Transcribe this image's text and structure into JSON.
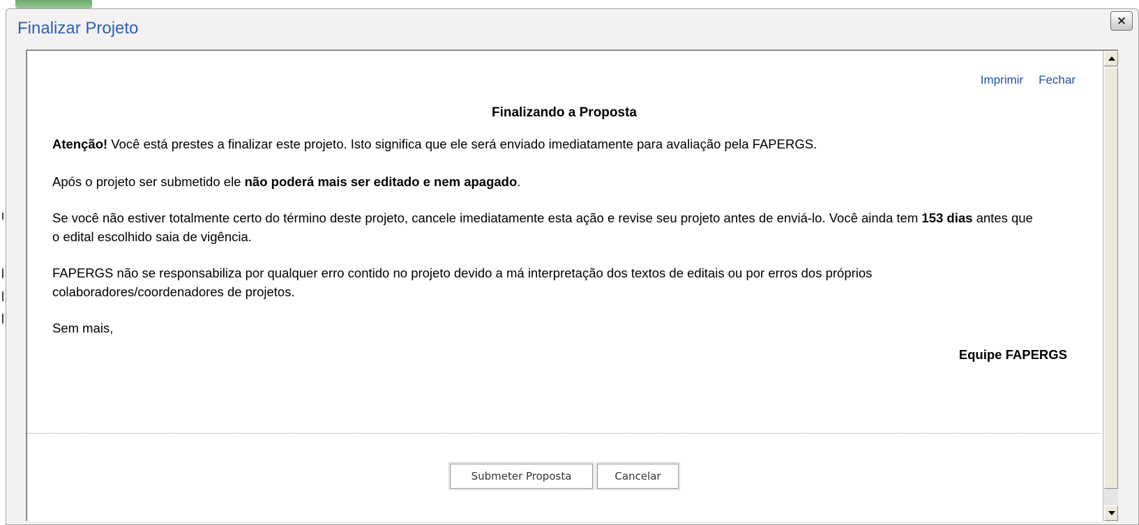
{
  "dialog": {
    "title": "Finalizar Projeto",
    "close_label": "×"
  },
  "links": {
    "print": "Imprimir",
    "close": "Fechar"
  },
  "content": {
    "heading": "Finalizando a Proposta",
    "p1_bold": "Atenção!",
    "p1_text": " Você está prestes a finalizar este projeto. Isto significa que ele será enviado imediatamente para avaliação pela FAPERGS.",
    "p2_text": "Após o projeto ser submetido ele ",
    "p2_bold": "não poderá mais ser editado e nem apagado",
    "p2_end": ".",
    "p3_text": "Se você não estiver totalmente certo do término deste projeto, cancele imediatamente esta ação e revise seu projeto antes de enviá-lo. Você ainda tem ",
    "p3_bold": "153 dias",
    "p3_end": " antes que o edital escolhido saia de vigência.",
    "p4_text": "FAPERGS não se responsabiliza por qualquer erro contido no projeto devido a má interpretação dos textos de editais ou por erros dos próprios colaboradores/coordenadores de projetos.",
    "p5_text": "Sem mais,",
    "signature": "Equipe FAPERGS"
  },
  "buttons": {
    "submit": "Submeter Proposta",
    "cancel": "Cancelar"
  },
  "icons": {
    "close": "close-icon",
    "scroll_up": "arrow-up-icon",
    "scroll_down": "arrow-down-icon"
  }
}
